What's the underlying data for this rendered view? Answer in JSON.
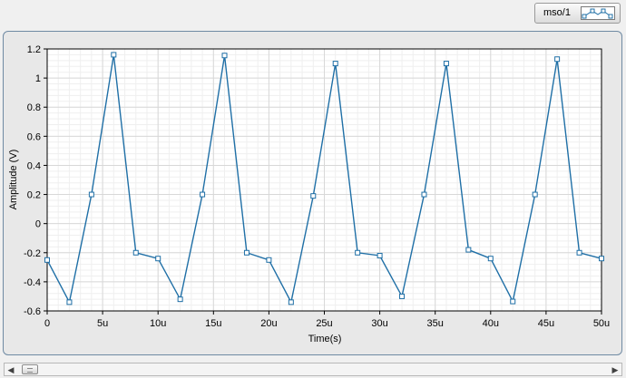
{
  "legend": {
    "label": "mso/1",
    "icon": "line-with-square-markers-icon"
  },
  "scrollbar": {
    "left_arrow": "◀",
    "right_arrow": "▶",
    "position": 0.0
  },
  "colors": {
    "series": "#1f6fa6",
    "plot_background": "#ffffff",
    "major_grid": "#d8d8d8",
    "minor_grid": "#efefef",
    "panel": "#e8e8e8"
  },
  "chart_data": {
    "type": "line",
    "title": "",
    "xlabel": "Time(s)",
    "ylabel": "Amplitude (V)",
    "xlim": [
      0,
      50
    ],
    "ylim": [
      -0.6,
      1.2
    ],
    "grid": true,
    "markers": "square",
    "x_ticks": [
      0,
      5,
      10,
      15,
      20,
      25,
      30,
      35,
      40,
      45,
      50
    ],
    "x_tick_labels": [
      "0",
      "5u",
      "10u",
      "15u",
      "20u",
      "25u",
      "30u",
      "35u",
      "40u",
      "45u",
      "50u"
    ],
    "y_ticks": [
      -0.6,
      -0.4,
      -0.2,
      0,
      0.2,
      0.4,
      0.6,
      0.8,
      1,
      1.2
    ],
    "y_tick_labels": [
      "-0.6",
      "-0.4",
      "-0.2",
      "0",
      "0.2",
      "0.4",
      "0.6",
      "0.8",
      "1",
      "1.2"
    ],
    "series": [
      {
        "x": [
          0,
          2,
          4,
          6,
          8,
          10,
          12,
          14,
          16,
          18,
          20,
          22,
          24,
          26,
          28,
          30,
          32,
          34,
          36,
          38,
          40,
          42,
          44,
          46,
          48,
          50
        ],
        "values": [
          -0.25,
          -0.54,
          0.2,
          1.16,
          -0.2,
          -0.24,
          -0.52,
          0.2,
          1.155,
          -0.2,
          -0.25,
          -0.54,
          0.19,
          1.1,
          -0.2,
          -0.22,
          -0.5,
          0.2,
          1.1,
          -0.18,
          -0.24,
          -0.535,
          0.2,
          1.13,
          -0.2,
          -0.24
        ]
      }
    ]
  }
}
